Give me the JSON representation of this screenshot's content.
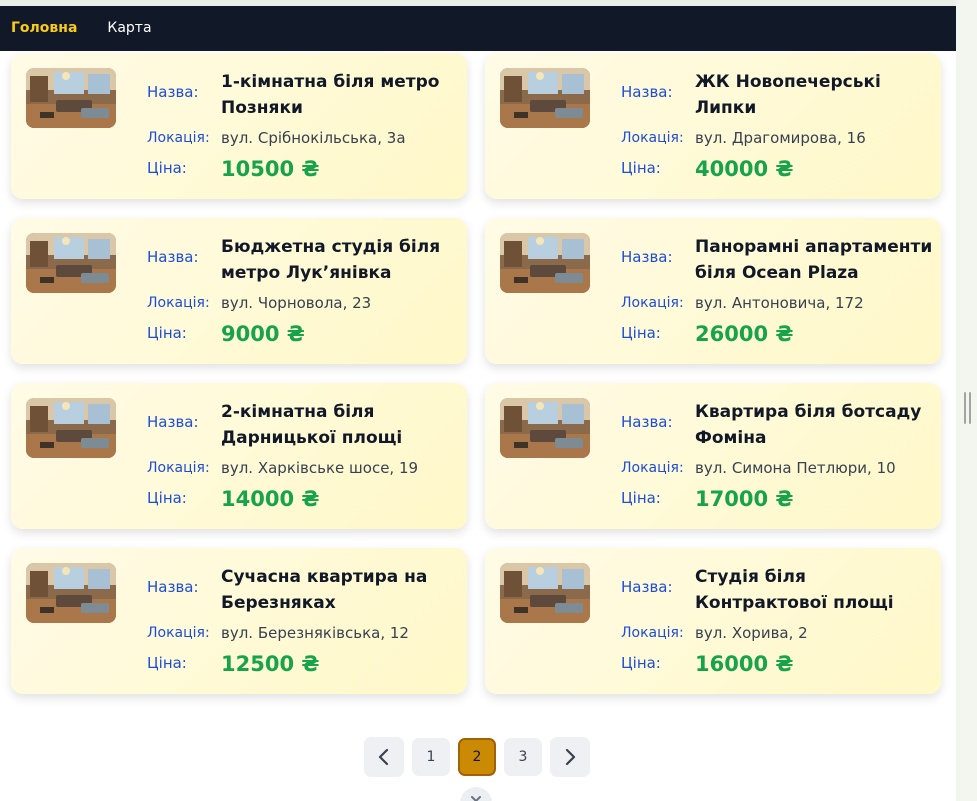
{
  "nav": {
    "home": "Головна",
    "map": "Карта"
  },
  "labels": {
    "name": "Назва:",
    "location": "Локація:",
    "price": "Ціна:"
  },
  "listings": [
    {
      "name": "1-кімнатна біля метро Позняки",
      "location": "вул. Срібнокільська, 3а",
      "price": "10500 ₴"
    },
    {
      "name": "ЖК Новопечерські Липки",
      "location": "вул. Драгомирова, 16",
      "price": "40000 ₴"
    },
    {
      "name": "Бюджетна студія біля метро Лук’янівка",
      "location": "вул. Чорновола, 23",
      "price": "9000 ₴"
    },
    {
      "name": "Панорамні апартаменти біля Ocean Plaza",
      "location": "вул. Антоновича, 172",
      "price": "26000 ₴"
    },
    {
      "name": "2-кімнатна біля Дарницької площі",
      "location": "вул. Харківське шосе, 19",
      "price": "14000 ₴"
    },
    {
      "name": "Квартира біля ботсаду Фоміна",
      "location": "вул. Симона Петлюри, 10",
      "price": "17000 ₴"
    },
    {
      "name": "Сучасна квартира на Березняках",
      "location": "вул. Березняківська, 12",
      "price": "12500 ₴"
    },
    {
      "name": "Студія біля Контрактової площі",
      "location": "вул. Хорива, 2",
      "price": "16000 ₴"
    }
  ],
  "pagination": {
    "prev_icon": "chevron-left-icon",
    "next_icon": "chevron-right-icon",
    "pages": [
      "1",
      "2",
      "3"
    ],
    "current": "2"
  },
  "colors": {
    "navbar_bg": "#111827",
    "nav_active": "#facc15",
    "label_blue": "#1d4ed8",
    "price_green": "#16a34a",
    "card_bg": "#fff8d6",
    "page_active": "#ca8a04"
  }
}
